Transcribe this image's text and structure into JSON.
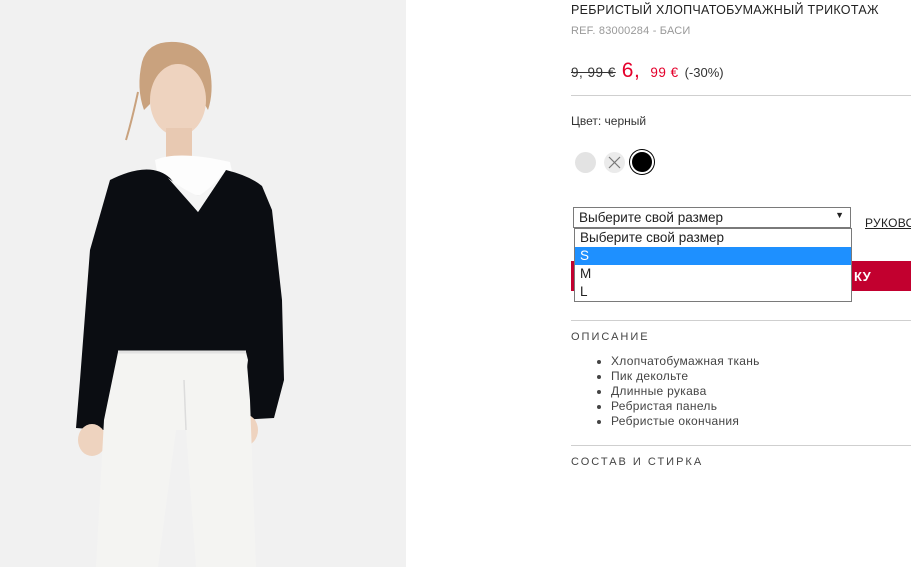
{
  "product": {
    "title": "РЕБРИСТЫЙ ХЛОПЧАТОБУМАЖНЫЙ ТРИКОТАЖ",
    "ref": "REF. 83000284 - БАСИ"
  },
  "price": {
    "old": "9, 99 €",
    "new_int": "6,",
    "new_dec": "99 €",
    "discount": "(-30%)",
    "accent_color": "#e4002b"
  },
  "color": {
    "label": "Цвет: черный",
    "swatches": [
      "light-grey",
      "unavailable",
      "black"
    ],
    "selected": "black"
  },
  "size": {
    "select_value": "Выберите свой размер",
    "guide_link": "РУКОВО",
    "options": [
      "Выберите свой размер",
      "S",
      "M",
      "L"
    ],
    "highlighted": "S"
  },
  "cart": {
    "button_label": "КУ",
    "button_color": "#c2002f"
  },
  "description": {
    "heading": "ОПИСАНИЕ",
    "items": [
      "Хлопчатобумажная ткань",
      "Пик декольте",
      "Длинные рукава",
      "Ребристая панель",
      "Ребристые окончания"
    ]
  },
  "composition": {
    "heading": "СОСТАВ И СТИРКА"
  }
}
